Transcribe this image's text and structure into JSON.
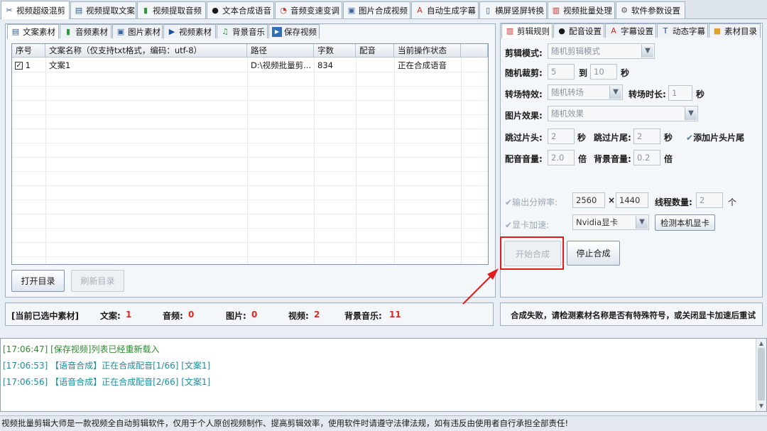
{
  "top_tabs": [
    {
      "label": "视频超级混剪",
      "icon": "scissors-icon",
      "active": true
    },
    {
      "label": "视频提取文案",
      "icon": "document-icon"
    },
    {
      "label": "视频提取音频",
      "icon": "audio-wave-icon"
    },
    {
      "label": "文本合成语音",
      "icon": "microphone-icon"
    },
    {
      "label": "音频变速变调",
      "icon": "speedometer-icon"
    },
    {
      "label": "图片合成视频",
      "icon": "image-icon"
    },
    {
      "label": "自动生成字幕",
      "icon": "subtitle-icon"
    },
    {
      "label": "横屏竖屏转换",
      "icon": "rotate-screen-icon"
    },
    {
      "label": "视频批量处理",
      "icon": "film-icon"
    },
    {
      "label": "软件参数设置",
      "icon": "gear-icon"
    }
  ],
  "left_tabs": [
    {
      "label": "文案素材",
      "icon": "document-icon",
      "active": true
    },
    {
      "label": "音频素材",
      "icon": "audio-wave-icon"
    },
    {
      "label": "图片素材",
      "icon": "image-icon"
    },
    {
      "label": "视频素材",
      "icon": "play-icon"
    },
    {
      "label": "背景音乐",
      "icon": "music-note-icon"
    },
    {
      "label": "保存视频",
      "icon": "play-box-icon"
    }
  ],
  "table": {
    "columns": [
      "序号",
      "文案名称（仅支持txt格式，编码：utf-8）",
      "路径",
      "字数",
      "配音",
      "当前操作状态"
    ],
    "rows": [
      {
        "index": "1",
        "name": "文案1",
        "path": "D:\\视频批量剪...",
        "words": "834",
        "voice": "",
        "status": "正在合成语音",
        "checked": true
      }
    ]
  },
  "left_buttons": {
    "open_dir": "打开目录",
    "refresh_dir": "刷新目录"
  },
  "summary": {
    "title": "[当前已选中素材]",
    "text_label": "文案:",
    "text_count": "1",
    "audio_label": "音频:",
    "audio_count": "0",
    "image_label": "图片:",
    "image_count": "0",
    "video_label": "视频:",
    "video_count": "2",
    "bgm_label": "背景音乐:",
    "bgm_count": "11"
  },
  "right_tabs": [
    {
      "label": "剪辑规则",
      "icon": "film-icon",
      "active": true
    },
    {
      "label": "配音设置",
      "icon": "microphone-icon"
    },
    {
      "label": "字幕设置",
      "icon": "subtitle-icon"
    },
    {
      "label": "动态字幕",
      "icon": "text-box-icon"
    },
    {
      "label": "素材目录",
      "icon": "folder-icon"
    }
  ],
  "settings": {
    "edit_mode_label": "剪辑模式:",
    "edit_mode_value": "随机剪辑模式",
    "random_cut_label": "随机裁剪:",
    "random_cut_from": "5",
    "random_cut_to_label": "到",
    "random_cut_to": "10",
    "sec_unit": "秒",
    "transition_label": "转场特效:",
    "transition_value": "随机转场",
    "transition_duration_label": "转场时长:",
    "transition_duration": "1",
    "image_effect_label": "图片效果:",
    "image_effect_value": "随机效果",
    "skip_head_label": "跳过片头:",
    "skip_head": "2",
    "skip_tail_label": "跳过片尾:",
    "skip_tail": "2",
    "add_head_tail_label": "添加片头片尾",
    "voice_volume_label": "配音音量:",
    "voice_volume": "2.0",
    "times_unit": "倍",
    "bg_volume_label": "背景音量:",
    "bg_volume": "0.2",
    "resolution_label": "输出分辨率:",
    "res_w": "2560",
    "res_x": "×",
    "res_h": "1440",
    "threads_label": "线程数量:",
    "threads": "2",
    "threads_unit": "个",
    "gpu_label": "显卡加速:",
    "gpu_value": "Nvidia显卡",
    "detect_gpu_button": "检测本机显卡",
    "start_button": "开始合成",
    "stop_button": "停止合成"
  },
  "error_message": "合成失败，请检测素材名称是否有特殊符号，或关闭显卡加速后重试",
  "log": [
    {
      "time": "[17:06:47]",
      "text": "[保存视频]列表已经重新载入",
      "color": "#2e8b2e"
    },
    {
      "time": "[17:06:53]",
      "text": "【语音合成】正在合成配音[1/66] [文案1]",
      "color": "#1a8fa0"
    },
    {
      "time": "[17:06:56]",
      "text": "【语音合成】正在合成配音[2/66] [文案1]",
      "color": "#1a8fa0"
    }
  ],
  "status_bar": "视频批量剪辑大师是一款视频全自动剪辑软件，仅用于个人原创视频制作、提高剪辑效率，使用软件时请遵守法律法规，如有违反由使用者自行承担全部责任!",
  "colors": {
    "accent_red": "#e1261c",
    "log_green": "#2e8b2e",
    "log_teal": "#1a8fa0"
  }
}
